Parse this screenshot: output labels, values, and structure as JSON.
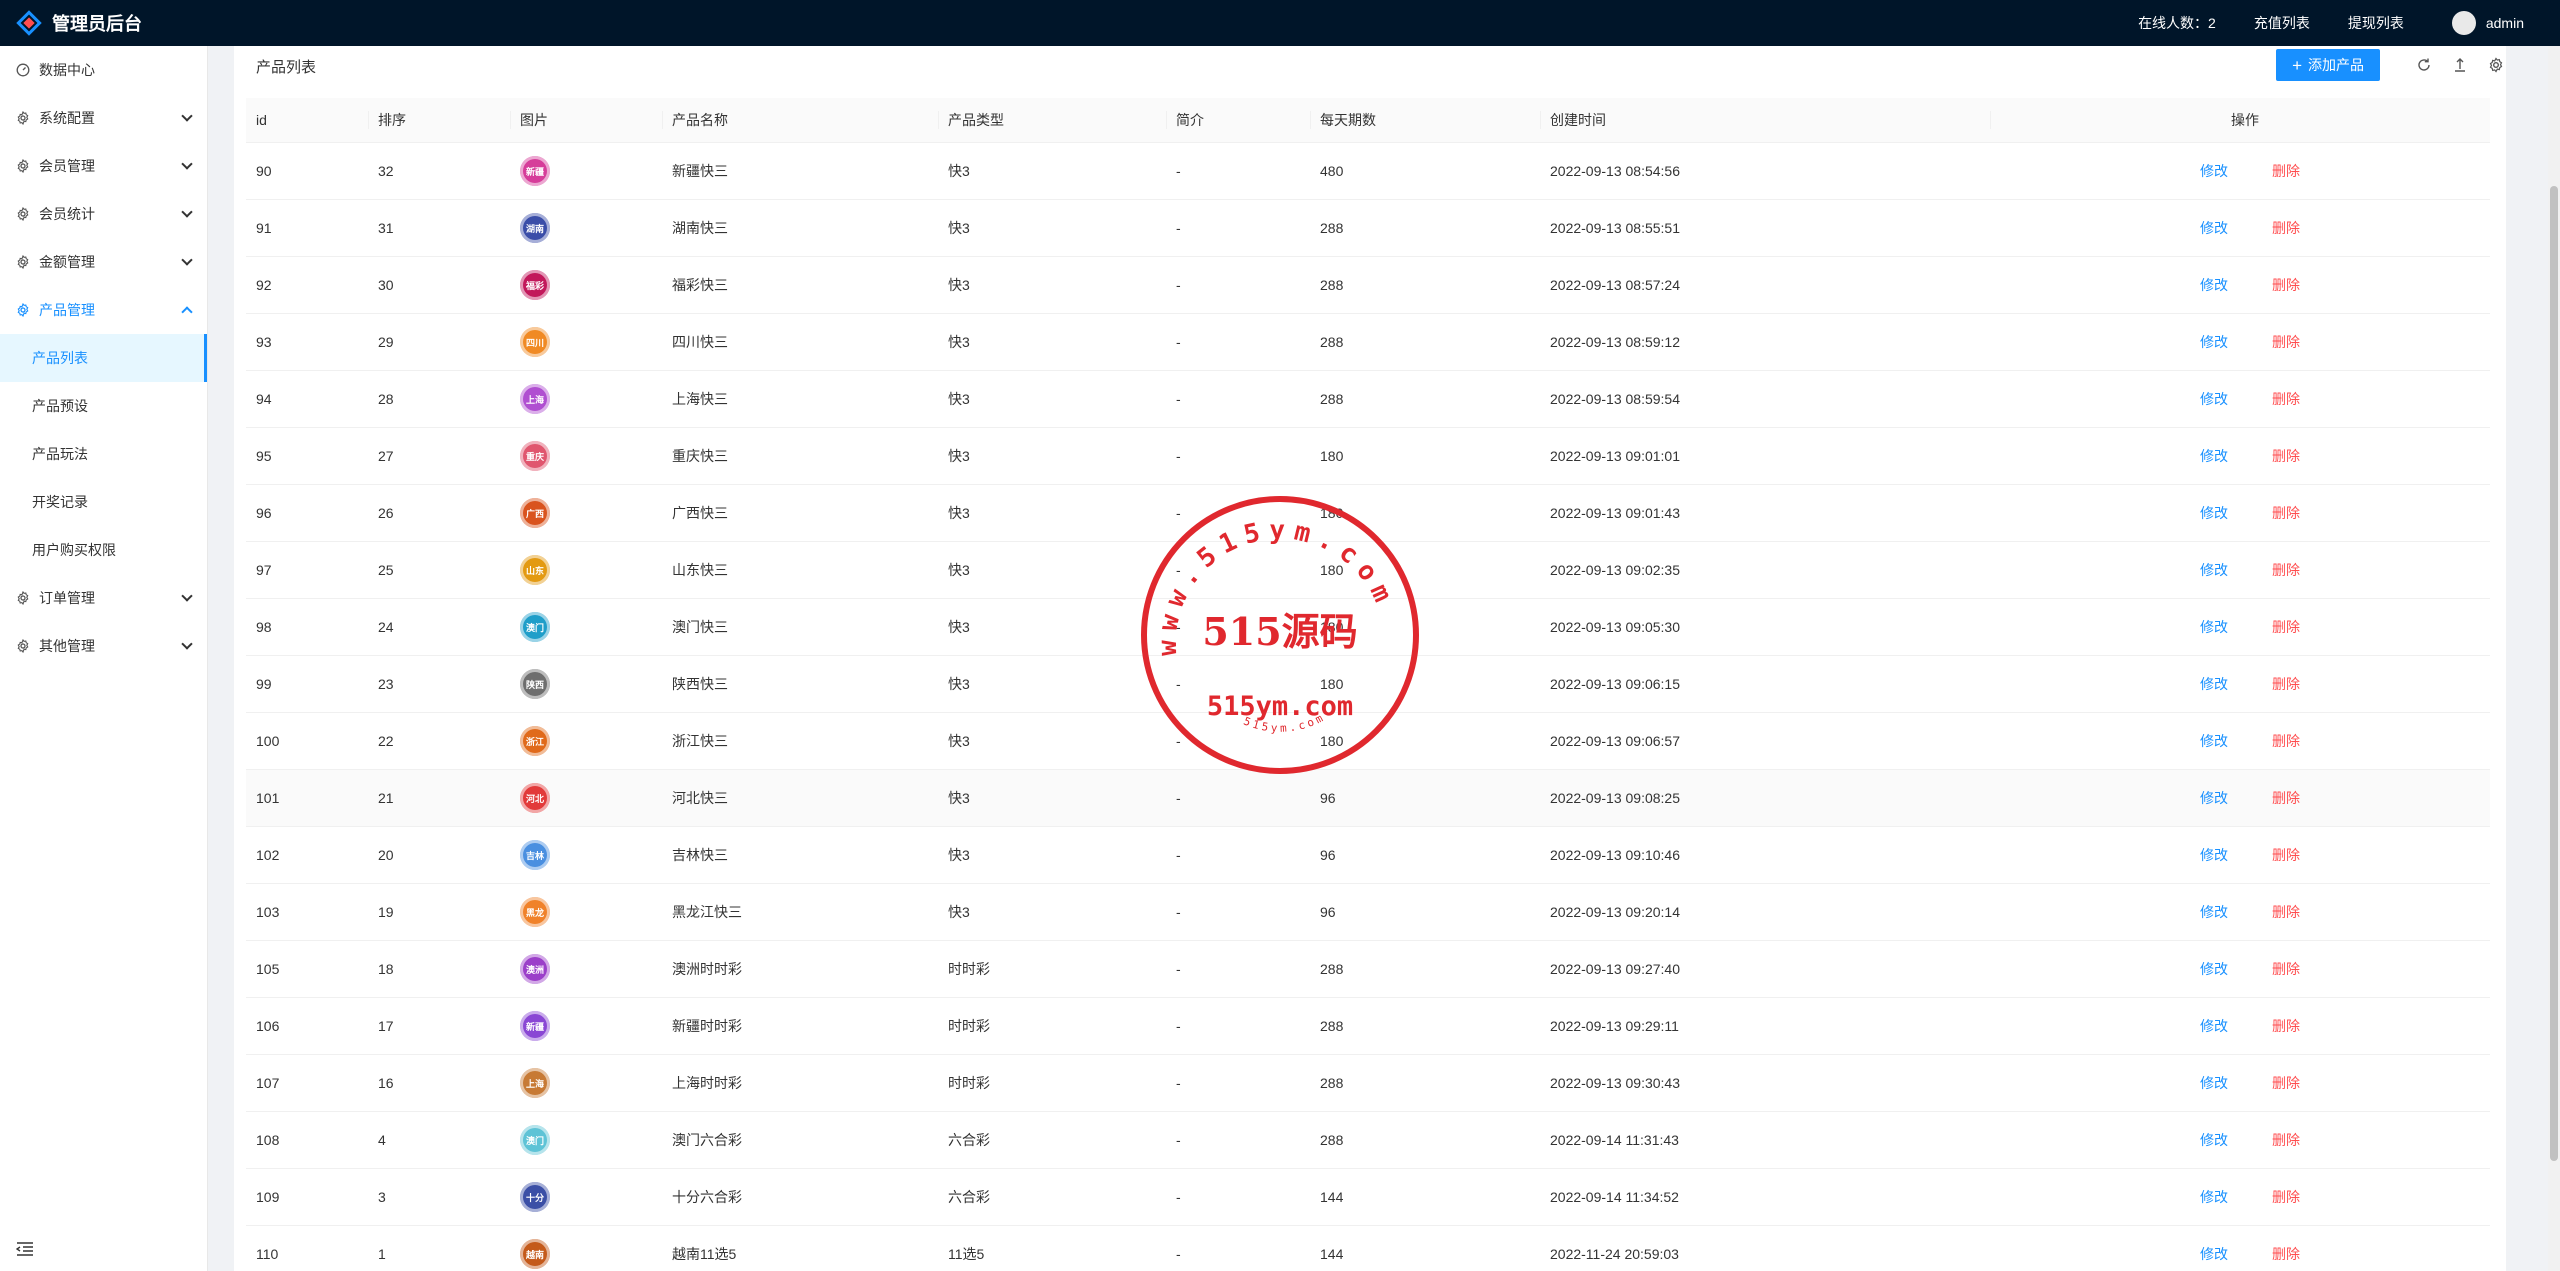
{
  "app": {
    "title": "管理员后台",
    "header": {
      "online_label": "在线人数：2",
      "recharge_link": "充值列表",
      "withdraw_link": "提现列表",
      "username": "admin"
    }
  },
  "sidebar": {
    "items": [
      {
        "label": "数据中心",
        "icon": "dashboard-icon",
        "expandable": false
      },
      {
        "label": "系统配置",
        "icon": "gear-icon",
        "expandable": true
      },
      {
        "label": "会员管理",
        "icon": "gear-icon",
        "expandable": true
      },
      {
        "label": "会员统计",
        "icon": "gear-icon",
        "expandable": true
      },
      {
        "label": "金额管理",
        "icon": "gear-icon",
        "expandable": true
      },
      {
        "label": "产品管理",
        "icon": "gear-icon",
        "expandable": true,
        "open": true
      },
      {
        "label": "订单管理",
        "icon": "gear-icon",
        "expandable": true
      },
      {
        "label": "其他管理",
        "icon": "gear-icon",
        "expandable": true
      }
    ],
    "product_submenu": [
      "产品列表",
      "产品预设",
      "产品玩法",
      "开奖记录",
      "用户购买权限"
    ],
    "active_submenu": "产品列表"
  },
  "main": {
    "title": "产品列表",
    "add_button": "添加产品",
    "columns": [
      "id",
      "排序",
      "图片",
      "产品名称",
      "产品类型",
      "简介",
      "每天期数",
      "创建时间",
      "操作"
    ],
    "actions": {
      "edit": "修改",
      "delete": "删除"
    },
    "rows": [
      {
        "id": "90",
        "sort": "32",
        "icon_color": "#d63d9a",
        "icon_text": "新疆",
        "name": "新疆快三",
        "type": "快3",
        "intro": "-",
        "periods": "480",
        "created": "2022-09-13 08:54:56"
      },
      {
        "id": "91",
        "sort": "31",
        "icon_color": "#3a4da8",
        "icon_text": "湖南",
        "name": "湖南快三",
        "type": "快3",
        "intro": "-",
        "periods": "288",
        "created": "2022-09-13 08:55:51"
      },
      {
        "id": "92",
        "sort": "30",
        "icon_color": "#c2185b",
        "icon_text": "福彩",
        "name": "福彩快三",
        "type": "快3",
        "intro": "-",
        "periods": "288",
        "created": "2022-09-13 08:57:24"
      },
      {
        "id": "93",
        "sort": "29",
        "icon_color": "#f08a24",
        "icon_text": "四川",
        "name": "四川快三",
        "type": "快3",
        "intro": "-",
        "periods": "288",
        "created": "2022-09-13 08:59:12"
      },
      {
        "id": "94",
        "sort": "28",
        "icon_color": "#b04fd1",
        "icon_text": "上海",
        "name": "上海快三",
        "type": "快3",
        "intro": "-",
        "periods": "288",
        "created": "2022-09-13 08:59:54"
      },
      {
        "id": "95",
        "sort": "27",
        "icon_color": "#e0566e",
        "icon_text": "重庆",
        "name": "重庆快三",
        "type": "快3",
        "intro": "-",
        "periods": "180",
        "created": "2022-09-13 09:01:01"
      },
      {
        "id": "96",
        "sort": "26",
        "icon_color": "#d9531e",
        "icon_text": "广西",
        "name": "广西快三",
        "type": "快3",
        "intro": "-",
        "periods": "180",
        "created": "2022-09-13 09:01:43"
      },
      {
        "id": "97",
        "sort": "25",
        "icon_color": "#e39a12",
        "icon_text": "山东",
        "name": "山东快三",
        "type": "快3",
        "intro": "-",
        "periods": "180",
        "created": "2022-09-13 09:02:35"
      },
      {
        "id": "98",
        "sort": "24",
        "icon_color": "#1f9ec9",
        "icon_text": "澳门",
        "name": "澳门快三",
        "type": "快3",
        "intro": "-",
        "periods": "180",
        "created": "2022-09-13 09:05:30"
      },
      {
        "id": "99",
        "sort": "23",
        "icon_color": "#6e6e6e",
        "icon_text": "陕西",
        "name": "陕西快三",
        "type": "快3",
        "intro": "-",
        "periods": "180",
        "created": "2022-09-13 09:06:15"
      },
      {
        "id": "100",
        "sort": "22",
        "icon_color": "#e06a1b",
        "icon_text": "浙江",
        "name": "浙江快三",
        "type": "快3",
        "intro": "-",
        "periods": "180",
        "created": "2022-09-13 09:06:57"
      },
      {
        "id": "101",
        "sort": "21",
        "icon_color": "#e23a3a",
        "icon_text": "河北",
        "name": "河北快三",
        "type": "快3",
        "intro": "-",
        "periods": "96",
        "created": "2022-09-13 09:08:25"
      },
      {
        "id": "102",
        "sort": "20",
        "icon_color": "#4a8fe0",
        "icon_text": "吉林",
        "name": "吉林快三",
        "type": "快3",
        "intro": "-",
        "periods": "96",
        "created": "2022-09-13 09:10:46"
      },
      {
        "id": "103",
        "sort": "19",
        "icon_color": "#f0822a",
        "icon_text": "黑龙",
        "name": "黑龙江快三",
        "type": "快3",
        "intro": "-",
        "periods": "96",
        "created": "2022-09-13 09:20:14"
      },
      {
        "id": "105",
        "sort": "18",
        "icon_color": "#9b3fc9",
        "icon_text": "澳洲",
        "name": "澳洲时时彩",
        "type": "时时彩",
        "intro": "-",
        "periods": "288",
        "created": "2022-09-13 09:27:40"
      },
      {
        "id": "106",
        "sort": "17",
        "icon_color": "#8a47d4",
        "icon_text": "新疆",
        "name": "新疆时时彩",
        "type": "时时彩",
        "intro": "-",
        "periods": "288",
        "created": "2022-09-13 09:29:11"
      },
      {
        "id": "107",
        "sort": "16",
        "icon_color": "#c77a35",
        "icon_text": "上海",
        "name": "上海时时彩",
        "type": "时时彩",
        "intro": "-",
        "periods": "288",
        "created": "2022-09-13 09:30:43"
      },
      {
        "id": "108",
        "sort": "4",
        "icon_color": "#5ec3d6",
        "icon_text": "澳门",
        "name": "澳门六合彩",
        "type": "六合彩",
        "intro": "-",
        "periods": "288",
        "created": "2022-09-14 11:31:43"
      },
      {
        "id": "109",
        "sort": "3",
        "icon_color": "#3b4fa6",
        "icon_text": "十分",
        "name": "十分六合彩",
        "type": "六合彩",
        "intro": "-",
        "periods": "144",
        "created": "2022-09-14 11:34:52"
      },
      {
        "id": "110",
        "sort": "1",
        "icon_color": "#c45a1b",
        "icon_text": "越南",
        "name": "越南11选5",
        "type": "11选5",
        "intro": "-",
        "periods": "144",
        "created": "2022-11-24 20:59:03"
      }
    ]
  },
  "watermark": {
    "ring_text": "www.515ym.com",
    "center_text": "515源码",
    "domain_text": "515ym.com",
    "small_text": "515ym.com",
    "color": "#e0282e"
  }
}
